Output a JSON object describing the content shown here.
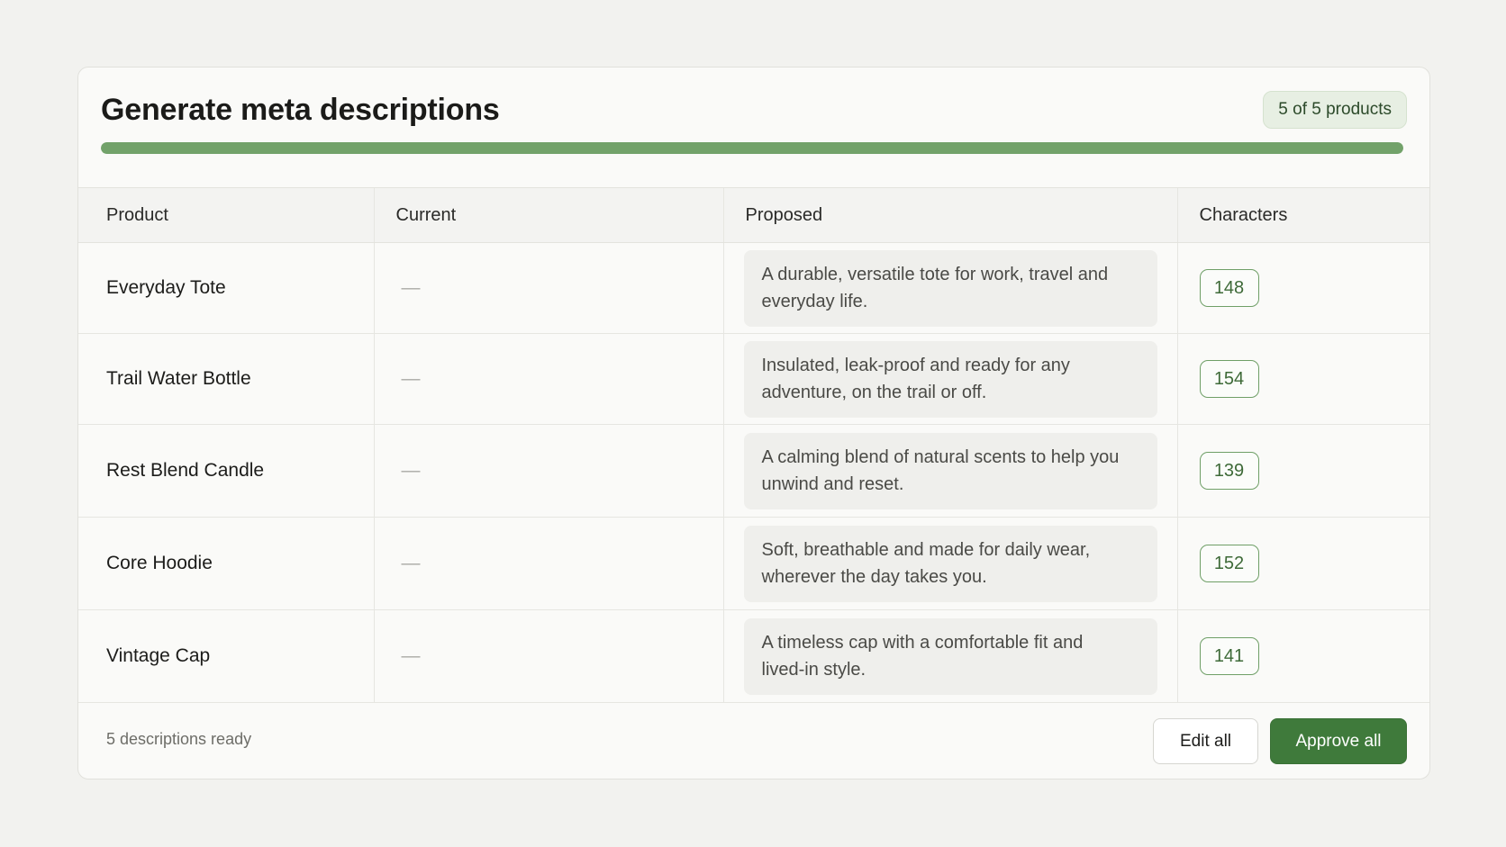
{
  "header": {
    "title": "Generate meta descriptions",
    "count_badge": "5 of 5 products",
    "progress_fraction": 1.0
  },
  "table": {
    "columns": [
      "Product",
      "Current",
      "Proposed",
      "Characters"
    ],
    "rows": [
      {
        "product": "Everyday Tote",
        "current": "—",
        "proposed": "A durable, versatile tote for work, travel and everyday life.",
        "characters": "148"
      },
      {
        "product": "Trail Water Bottle",
        "current": "—",
        "proposed": "Insulated, leak-proof and ready for any adventure, on the trail or off.",
        "characters": "154"
      },
      {
        "product": "Rest Blend Candle",
        "current": "—",
        "proposed": "A calming blend of natural scents to help you unwind and reset.",
        "characters": "139"
      },
      {
        "product": "Core Hoodie",
        "current": "—",
        "proposed": "Soft, breathable and made for daily wear, wherever the day takes you.",
        "characters": "152"
      },
      {
        "product": "Vintage Cap",
        "current": "—",
        "proposed": "A timeless cap with a comfortable fit and lived-in style.",
        "characters": "141"
      }
    ]
  },
  "footer": {
    "status": "5 descriptions ready",
    "edit_label": "Edit all",
    "approve_label": "Approve all"
  },
  "colors": {
    "accent": "#3f7a3b",
    "progress": "#72a26a",
    "badge_border": "#6f9f67"
  }
}
